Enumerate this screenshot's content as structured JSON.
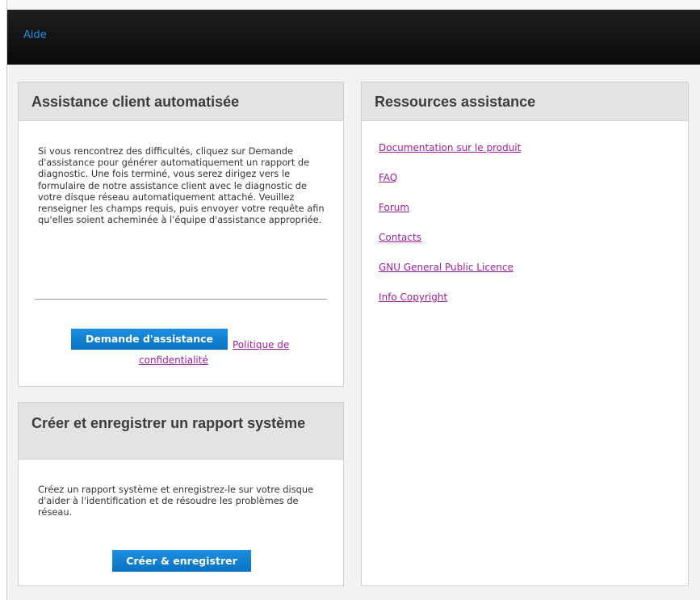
{
  "topbar": {
    "aide": "Aide"
  },
  "assistance": {
    "title": "Assistance client automatisée",
    "description": "Si vous rencontrez des difficultés, cliquez sur Demande d'assistance pour générer automatiquement un rapport de diagnostic. Une fois terminé, vous serez dirigez vers le formulaire de notre assistance client avec le diagnostic de votre disque réseau automatiquement attaché. Veuillez renseigner les champs requis, puis envoyer votre requête afin qu'elles soient acheminée à l'équipe d'assistance appropriée.",
    "button": "Demande d'assistance",
    "privacy_link_line1": "Politique de",
    "privacy_link_line2": "confidentialité"
  },
  "rapport": {
    "title": "Créer et enregistrer un rapport système",
    "description": "Créez un rapport système et enregistrez-le sur votre disque d'aider à l'identification et de résoudre les problèmes de réseau.",
    "button": "Créer & enregistrer"
  },
  "ressources": {
    "title": "Ressources assistance",
    "links": [
      "Documentation sur le produit",
      "FAQ",
      "Forum",
      "Contacts",
      "GNU General Public Licence",
      "Info Copyright"
    ]
  },
  "colors": {
    "topbar": "#111111",
    "aide_link": "#1a8ee6",
    "button": "#0a72c2",
    "link": "#9b1f9b",
    "panel_header": "#e3e3e3"
  }
}
